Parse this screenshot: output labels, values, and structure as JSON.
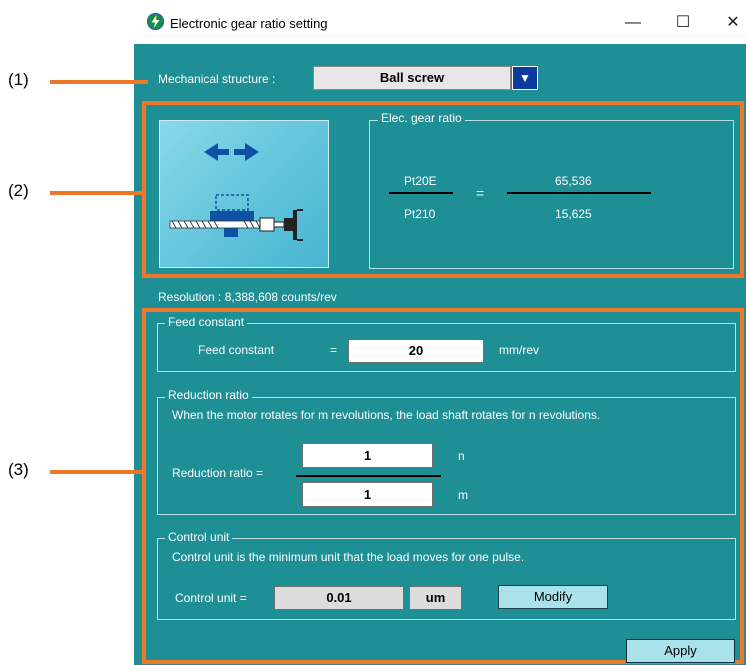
{
  "window": {
    "title": "Electronic gear ratio setting",
    "controls": {
      "minimize": "—",
      "maximize": "☐",
      "close": "✕"
    }
  },
  "callouts": [
    "(1)",
    "(2)",
    "(3)"
  ],
  "mechanical_structure": {
    "label": "Mechanical structure :",
    "value": "Ball screw",
    "dropdown_glyph": "▼"
  },
  "gear_ratio": {
    "legend": "Elec. gear ratio",
    "numerator_param": "Pt20E",
    "denominator_param": "Pt210",
    "equals": "=",
    "numerator_value": "65,536",
    "denominator_value": "15,625"
  },
  "resolution": "Resolution : 8,388,608 counts/rev",
  "feed_constant": {
    "legend": "Feed constant",
    "label": "Feed constant",
    "equals": "=",
    "value": "20",
    "unit": "mm/rev"
  },
  "reduction_ratio": {
    "legend": "Reduction ratio",
    "description": "When the motor rotates for m revolutions, the load shaft rotates for n revolutions.",
    "label": "Reduction ratio  =",
    "n_value": "1",
    "n_label": "n",
    "m_value": "1",
    "m_label": "m"
  },
  "control_unit": {
    "legend": "Control unit",
    "description": "Control unit is the minimum unit that the load moves for one pulse.",
    "label": "Control unit  =",
    "value": "0.01",
    "unit": "um",
    "modify_label": "Modify"
  },
  "apply_label": "Apply",
  "colors": {
    "window_bg": "#1e8f95",
    "highlight": "#ee7828",
    "dropdown_btn": "#0d3a9e",
    "button_bg": "#a9e2ea",
    "illustration_arrow": "#0f52a3"
  },
  "icons": {
    "app": "lightning-app-icon",
    "illustration": "ball-screw-mechanism-icon"
  }
}
